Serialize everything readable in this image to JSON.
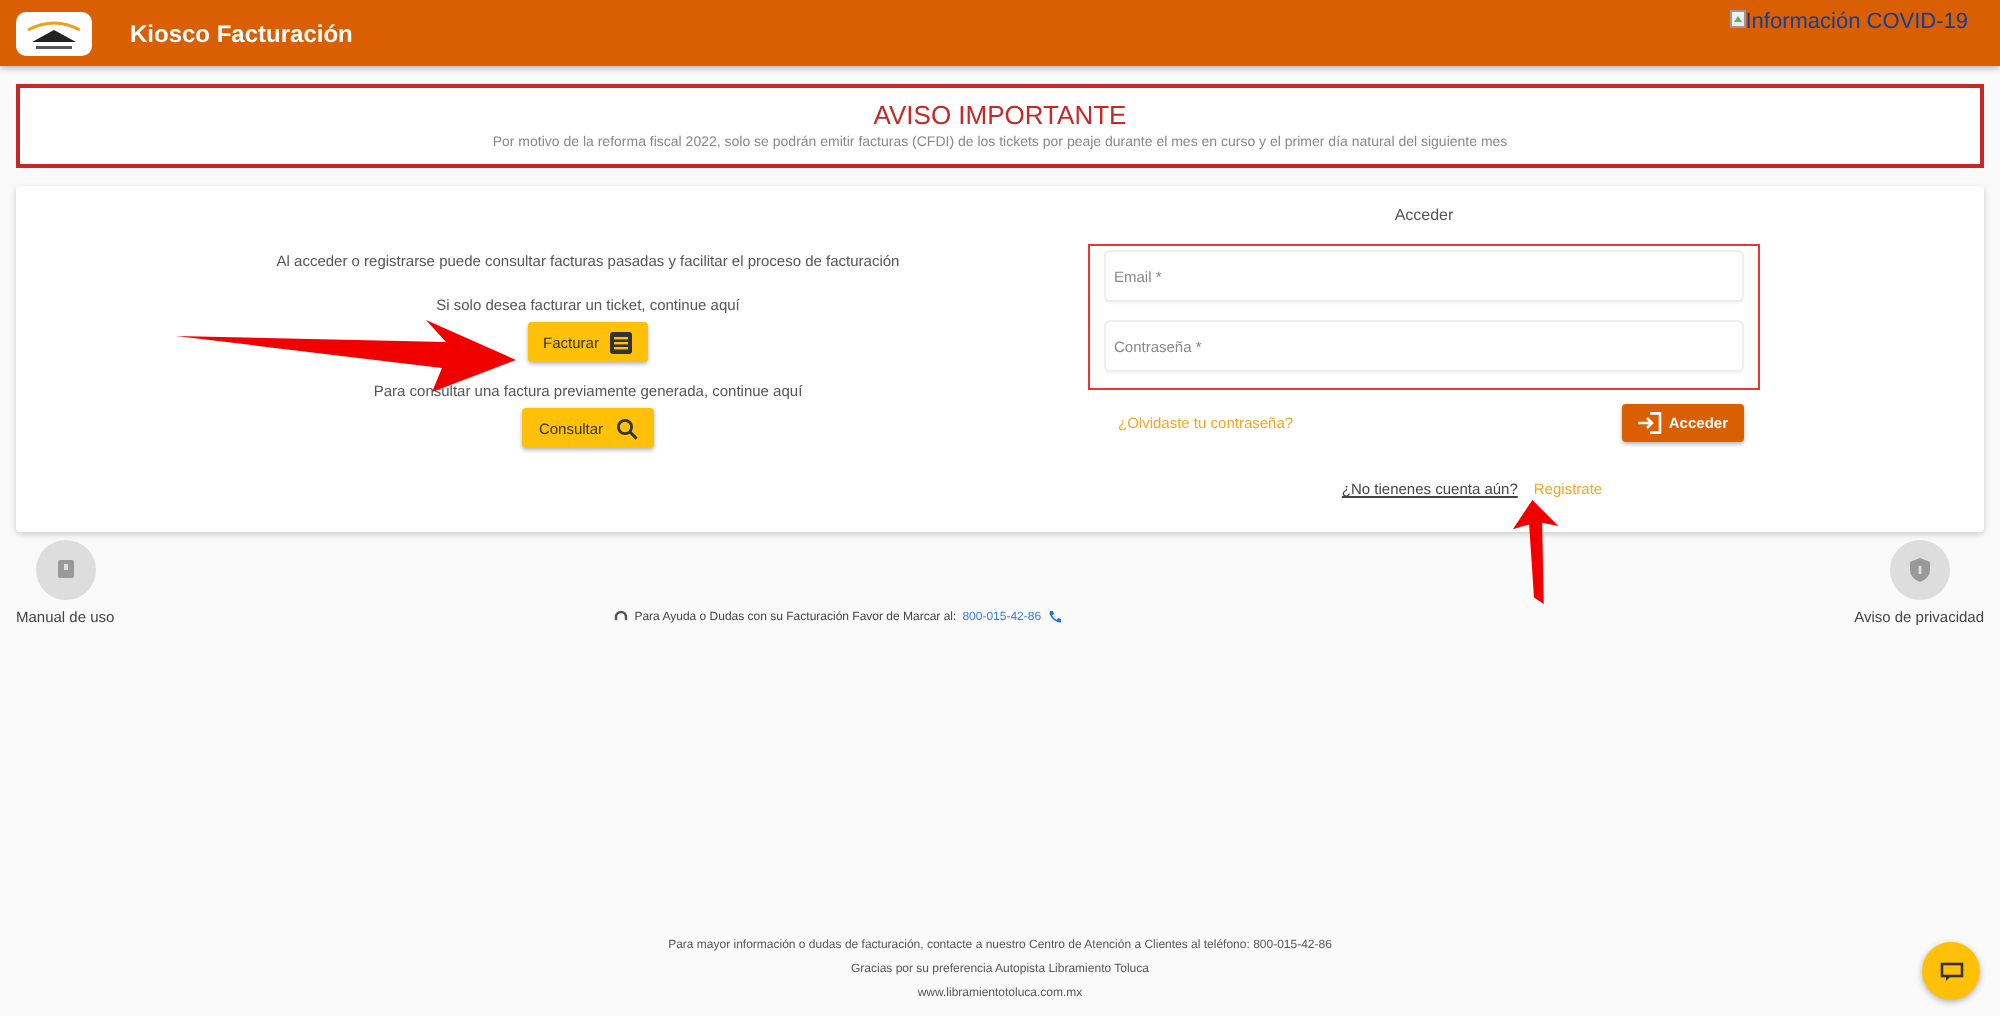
{
  "header": {
    "title": "Kiosco Facturación",
    "covid_link": "Información COVID-19"
  },
  "notice": {
    "title": "AVISO IMPORTANTE",
    "text": "Por motivo de la reforma fiscal 2022, solo se podrán emitir facturas (CFDI) de los tickets por peaje durante el mes en curso y el primer día natural del siguiente mes"
  },
  "invoice_panel": {
    "intro": "Al acceder o registrarse puede consultar facturas pasadas y facilitar el proceso de facturación",
    "facturar_prompt": "Si solo desea facturar un ticket, continue aquí",
    "facturar_button": "Facturar",
    "consultar_prompt": "Para consultar una factura previamente generada, continue aquí",
    "consultar_button": "Consultar"
  },
  "login": {
    "title": "Acceder",
    "fields": [
      {
        "placeholder": "Email *"
      },
      {
        "placeholder": "Contraseña *"
      }
    ],
    "forgot_link": "¿Olvidaste tu contraseña?",
    "submit_button": "Acceder",
    "no_account": "¿No tienenes cuenta aún?",
    "register_link": "Registrate"
  },
  "links": [
    {
      "label": "Manual de uso",
      "kind": "manual"
    },
    {
      "label": "Aviso de privacidad",
      "kind": "privacy"
    }
  ],
  "help": {
    "text": "Para Ayuda o Dudas con su Facturación Favor de Marcar al:",
    "phone": "800-015-42-86"
  },
  "footer": [
    "Para mayor información o dudas de facturación, contacte a nuestro Centro de Atención a Clientes al teléfono: 800-015-42-86",
    "Gracias por su preferencia Autopista Libramiento Toluca",
    "www.libramientotoluca.com.mx"
  ]
}
